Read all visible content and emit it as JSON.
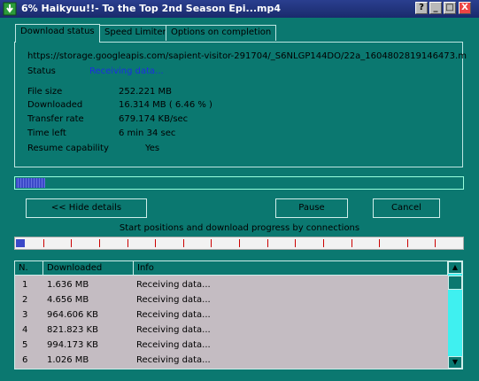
{
  "window": {
    "title": "6% Haikyuu!!- To the Top 2nd Season Epi...mp4",
    "buttons": {
      "help": "?",
      "minimize": "_",
      "maximize": "□",
      "close": "X"
    }
  },
  "tabs": [
    {
      "label": "Download status",
      "active": true
    },
    {
      "label": "Speed Limiter",
      "active": false
    },
    {
      "label": "Options on completion",
      "active": false
    }
  ],
  "status_panel": {
    "url": "https://storage.googleapis.com/sapient-visitor-291704/_S6NLGP144DO/22a_1604802819146473.m",
    "status_label": "Status",
    "status_value": "Receiving data...",
    "fields": [
      {
        "label": "File size",
        "value": "252.221  MB"
      },
      {
        "label": "Downloaded",
        "value": "16.314  MB  ( 6.46 % )"
      },
      {
        "label": "Transfer rate",
        "value": "679.174  KB/sec"
      },
      {
        "label": "Time left",
        "value": "6 min 34 sec"
      },
      {
        "label": "Resume capability",
        "value": "Yes"
      }
    ]
  },
  "progress": {
    "fraction": 0.0646
  },
  "buttons": {
    "hide_details": "<< Hide details",
    "pause": "Pause",
    "cancel": "Cancel"
  },
  "connections": {
    "label": "Start positions and download progress by connections",
    "count": 16
  },
  "table": {
    "columns": [
      "N.",
      "Downloaded",
      "Info"
    ],
    "rows": [
      {
        "n": "1",
        "downloaded": "1.636  MB",
        "info": "Receiving data..."
      },
      {
        "n": "2",
        "downloaded": "4.656  MB",
        "info": "Receiving data..."
      },
      {
        "n": "3",
        "downloaded": "964.606  KB",
        "info": "Receiving data..."
      },
      {
        "n": "4",
        "downloaded": "821.823  KB",
        "info": "Receiving data..."
      },
      {
        "n": "5",
        "downloaded": "994.173  KB",
        "info": "Receiving data..."
      },
      {
        "n": "6",
        "downloaded": "1.026  MB",
        "info": "Receiving data..."
      }
    ]
  },
  "colors": {
    "background": "#0b7870",
    "accent": "#3b49c8",
    "status_text": "#1c2fe0"
  }
}
